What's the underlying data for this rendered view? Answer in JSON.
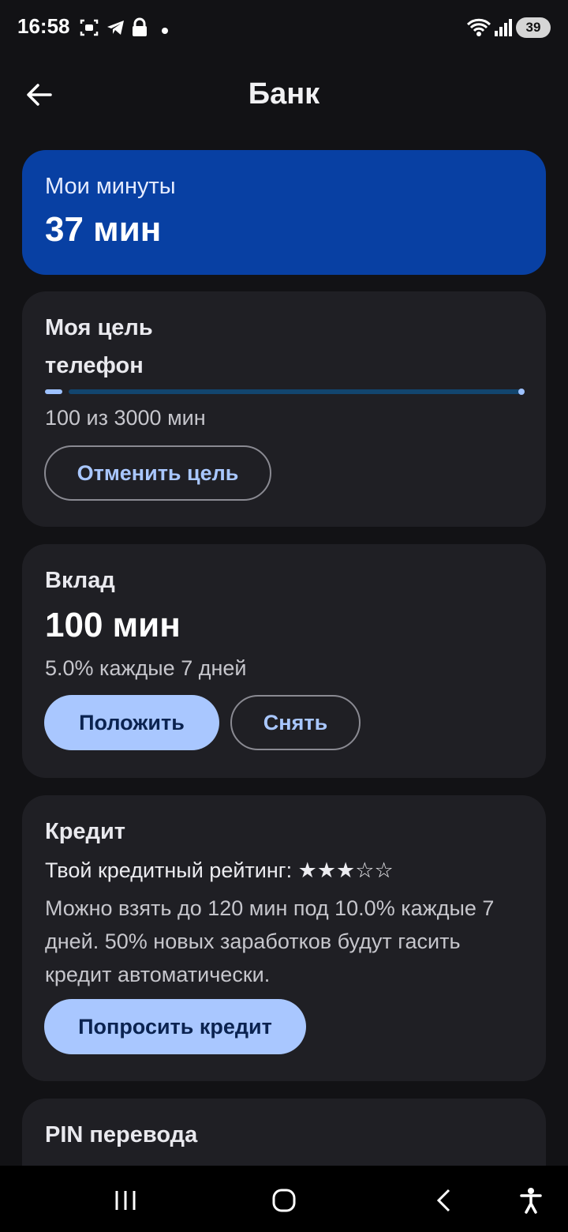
{
  "status_bar": {
    "time": "16:58",
    "battery": "39"
  },
  "header": {
    "title": "Банк"
  },
  "minutes_card": {
    "label": "Мои минуты",
    "value": "37 мин"
  },
  "goal_card": {
    "label": "Моя цель",
    "goal_name": "телефон",
    "progress_text": "100 из 3000 мин",
    "progress_fraction": 0.033,
    "cancel_label": "Отменить цель"
  },
  "deposit_card": {
    "label": "Вклад",
    "value": "100 мин",
    "rate": "5.0% каждые 7 дней",
    "deposit_label": "Положить",
    "withdraw_label": "Снять"
  },
  "credit_card": {
    "label": "Кредит",
    "rating": "Твой кредитный рейтинг: ★★★☆☆",
    "description": "Можно взять до 120 мин под 10.0% каждые 7 дней. 50% новых заработков будут гасить кредит автоматически.",
    "request_label": "Попросить кредит"
  },
  "pin_card": {
    "label": "PIN перевода"
  },
  "icons": [
    "back-arrow-icon",
    "recent-apps-icon",
    "home-icon",
    "nav-back-icon",
    "accessibility-icon",
    "wifi-icon",
    "signal-icon",
    "lock-icon",
    "telegram-icon",
    "screenshot-icon"
  ]
}
